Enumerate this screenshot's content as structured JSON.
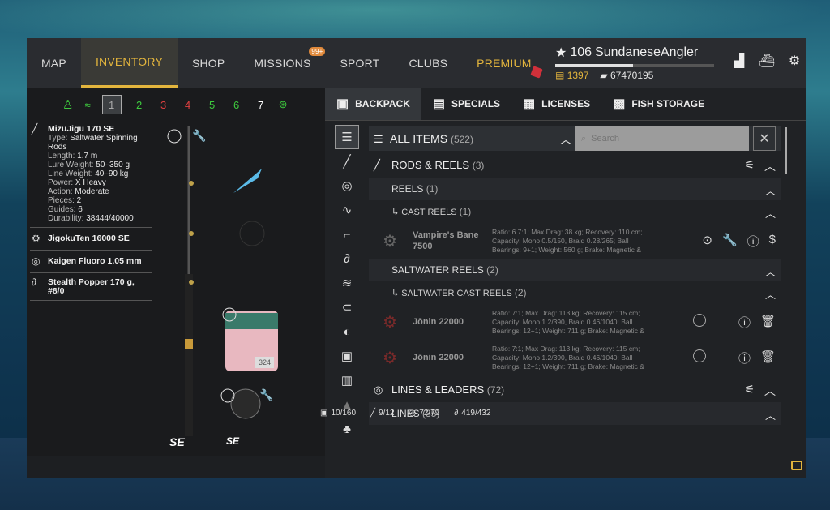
{
  "nav": {
    "items": [
      "MAP",
      "INVENTORY",
      "SHOP",
      "MISSIONS",
      "SPORT",
      "CLUBS",
      "PREMIUM"
    ],
    "missions_badge": "99+"
  },
  "profile": {
    "level": "106",
    "name": "SundaneseAngler",
    "xp_fraction": 0.49,
    "gold": "1397",
    "silver": "67470195"
  },
  "icons": {
    "top": [
      "leaderboard-icon",
      "boat-icon",
      "gear-icon"
    ]
  },
  "slots": {
    "numbers": [
      "1",
      "2",
      "3",
      "4",
      "5",
      "6",
      "7"
    ],
    "colors": [
      "#aaaaaa",
      "#3ecb3e",
      "#e04040",
      "#e04040",
      "#3ecb3e",
      "#3ecb3e",
      "#ffffff"
    ]
  },
  "rod_details": {
    "title": "MizuJigu 170 SE",
    "type_label": "Type:",
    "type": "Saltwater Spinning Rods",
    "length_label": "Length:",
    "length": "1.7 m",
    "lure_label": "Lure Weight:",
    "lure": "50–350 g",
    "line_label": "Line Weight:",
    "line": "40–90 kg",
    "power_label": "Power:",
    "power": "X Heavy",
    "action_label": "Action:",
    "action": "Moderate",
    "pieces_label": "Pieces:",
    "pieces": "2",
    "guides_label": "Guides:",
    "guides": "6",
    "durability_label": "Durability:",
    "durability": "38444/40000"
  },
  "reel_detail": "JigokuTen 16000 SE",
  "line_detail": "Kaigen Fluoro 1.05 mm",
  "lure_detail": "Stealth Popper 170 g, #8/0",
  "spool_count": "324",
  "subtabs": [
    "BACKPACK",
    "SPECIALS",
    "LICENSES",
    "FISH STORAGE"
  ],
  "list": {
    "all_label": "ALL ITEMS",
    "all_count": "(522)",
    "search_placeholder": "Search",
    "rods_reels_label": "RODS & REELS",
    "rods_reels_count": "(3)",
    "reels_label": "REELS",
    "reels_count": "(1)",
    "cast_reels_label": "CAST REELS",
    "cast_reels_count": "(1)",
    "vampire_name": "Vampire's Bane 7500",
    "vampire_desc": "Ratio: 6.7:1; Max Drag: 38 kg; Recovery: 110 cm; Capacity: Mono 0.5/150, Braid 0.28/265; Ball Bearings: 9+1; Weight: 560 g; Brake: Magnetic &",
    "salt_reels_label": "SALTWATER REELS",
    "salt_reels_count": "(2)",
    "salt_cast_label": "SALTWATER CAST REELS",
    "salt_cast_count": "(2)",
    "jonin_name": "Jōnin 22000",
    "jonin_desc": "Ratio: 7:1; Max Drag: 113 kg; Recovery: 115 cm; Capacity: Mono 1.2/390, Braid 0.46/1040; Ball Bearings: 12+1; Weight: 711 g; Brake: Magnetic &",
    "lines_leaders_label": "LINES & LEADERS",
    "lines_leaders_count": "(72)",
    "lines_label": "LINES",
    "lines_count": "(35)"
  },
  "status": {
    "backpack": "10/160",
    "rods": "9/12",
    "lines": "72/79",
    "tackle": "419/432"
  }
}
